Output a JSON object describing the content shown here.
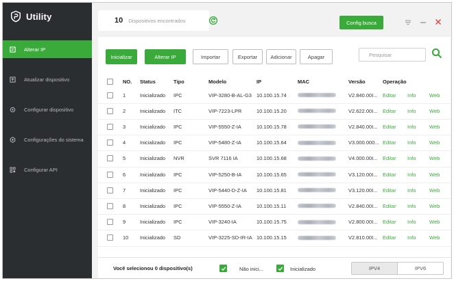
{
  "app": {
    "title": "Utility",
    "logo_icon": "shield-logo-icon"
  },
  "sidebar": {
    "items": [
      {
        "label": "Alterar IP",
        "icon": "edit-ip-icon",
        "active": true
      },
      {
        "label": "Atualizar dispositivo",
        "icon": "upgrade-icon",
        "active": false
      },
      {
        "label": "Configurar dispositivo",
        "icon": "settings-icon",
        "active": false
      },
      {
        "label": "Configurações do sistema",
        "icon": "gear-icon",
        "active": false
      },
      {
        "label": "Configurar API",
        "icon": "api-icon",
        "active": false
      }
    ]
  },
  "header": {
    "device_count": "10",
    "device_count_label": "Dispositivos encontrados",
    "config_button": "Config busca"
  },
  "toolbar": {
    "initialize": "Inicializar",
    "change_ip": "Alterar IP",
    "import": "Importar",
    "export": "Exportar",
    "add": "Adicionar",
    "delete": "Apagar",
    "search_placeholder": "Pesquisar"
  },
  "table": {
    "columns": {
      "no": "NO.",
      "status": "Status",
      "type": "Tipo",
      "model": "Modelo",
      "ip": "IP",
      "mac": "MAC",
      "version": "Versão",
      "operation": "Operação"
    },
    "rows": [
      {
        "no": "1",
        "status": "Inicializado",
        "type": "IPC",
        "model": "VIP-3280-B-AL-G3",
        "ip": "10.100.15.74",
        "version": "V2.840.00I...",
        "edit": "Editar",
        "info": "Info",
        "web": "Web"
      },
      {
        "no": "2",
        "status": "Inicializado",
        "type": "ITC",
        "model": "VIP-7223-LPR",
        "ip": "10.100.15.20",
        "version": "V2.622.00I...",
        "edit": "Editar",
        "info": "Info",
        "web": "Web"
      },
      {
        "no": "3",
        "status": "Inicializado",
        "type": "IPC",
        "model": "VIP-5550-Z-IA",
        "ip": "10.100.15.78",
        "version": "V2.840.00I...",
        "edit": "Editar",
        "info": "Info",
        "web": "Web"
      },
      {
        "no": "4",
        "status": "Inicializado",
        "type": "IPC",
        "model": "VIP-5480-Z-IA",
        "ip": "10.100.15.64",
        "version": "V3.000.000...",
        "edit": "Editar",
        "info": "Info",
        "web": "Web"
      },
      {
        "no": "5",
        "status": "Inicializado",
        "type": "NVR",
        "model": "SVR 7116 IA",
        "ip": "10.100.15.68",
        "version": "V4.000.00I...",
        "edit": "Editar",
        "info": "Info",
        "web": "Web"
      },
      {
        "no": "6",
        "status": "Inicializado",
        "type": "IPC",
        "model": "VIP-5250-B-IA",
        "ip": "10.100.15.65",
        "version": "V3.120.00I...",
        "edit": "Editar",
        "info": "Info",
        "web": "Web"
      },
      {
        "no": "7",
        "status": "Inicializado",
        "type": "IPC",
        "model": "VIP-5440-D-Z-IA",
        "ip": "10.100.15.81",
        "version": "V3.120.00I...",
        "edit": "Editar",
        "info": "Info",
        "web": "Web"
      },
      {
        "no": "8",
        "status": "Inicializado",
        "type": "IPC",
        "model": "VIP-5550-Z-IA",
        "ip": "10.100.15.11",
        "version": "V2.840.00I...",
        "edit": "Editar",
        "info": "Info",
        "web": "Web"
      },
      {
        "no": "9",
        "status": "Inicializado",
        "type": "IPC",
        "model": "VIP-3240-IA",
        "ip": "10.100.15.75",
        "version": "V2.800.00I...",
        "edit": "Editar",
        "info": "Info",
        "web": "Web"
      },
      {
        "no": "10",
        "status": "Inicializado",
        "type": "SD",
        "model": "VIP-3225-SD-IR-IA",
        "ip": "10.100.15.15",
        "version": "V2.810.00I...",
        "edit": "Editar",
        "info": "Info",
        "web": "Web"
      }
    ]
  },
  "footer": {
    "selected_text": "Você selecionou 0 dispositivo(s)",
    "filter_not_init": "Não inici...",
    "filter_init": "Inicializado",
    "ipv4": "IPV4",
    "ipv6": "IPV6"
  },
  "colors": {
    "accent": "#3aaa3a",
    "sidebar_bg": "#2b2e31"
  }
}
